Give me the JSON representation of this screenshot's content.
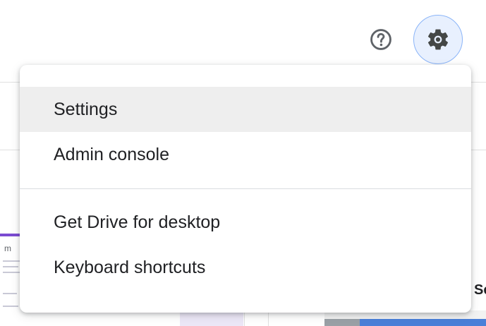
{
  "topbar": {
    "help_icon": "help-circle-icon",
    "settings_icon": "gear-icon",
    "accent_color": "#8ab4f8",
    "active_bg": "#e8f0fe"
  },
  "menu": {
    "group1": [
      {
        "label": "Settings",
        "highlighted": true
      },
      {
        "label": "Admin console",
        "highlighted": false
      }
    ],
    "group2": [
      {
        "label": "Get Drive for desktop",
        "highlighted": false
      },
      {
        "label": "Keyboard shortcuts",
        "highlighted": false
      }
    ]
  },
  "background": {
    "partial_text_right": "Sc",
    "partial_text_left": "m"
  }
}
